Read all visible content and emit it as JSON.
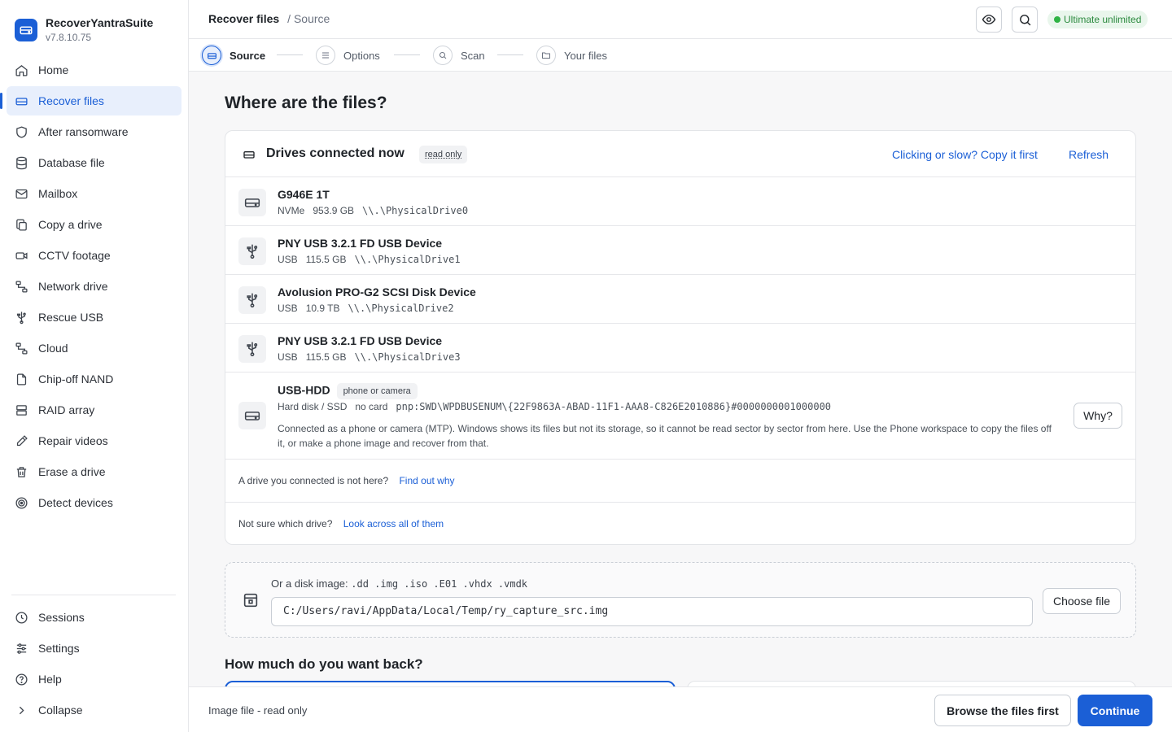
{
  "app": {
    "name": "RecoverYantraSuite",
    "version": "v7.8.10.75"
  },
  "sidebar": {
    "items": [
      {
        "label": "Home",
        "icon": "home-icon"
      },
      {
        "label": "Recover files",
        "icon": "drive-icon",
        "active": true
      },
      {
        "label": "After ransomware",
        "icon": "shield-icon"
      },
      {
        "label": "Database file",
        "icon": "database-icon"
      },
      {
        "label": "Mailbox",
        "icon": "mail-icon"
      },
      {
        "label": "Copy a drive",
        "icon": "copy-icon"
      },
      {
        "label": "CCTV footage",
        "icon": "camera-icon"
      },
      {
        "label": "Network drive",
        "icon": "network-icon"
      },
      {
        "label": "Rescue USB",
        "icon": "usb-icon"
      },
      {
        "label": "Cloud",
        "icon": "cloud-icon"
      },
      {
        "label": "Chip-off NAND",
        "icon": "chip-icon"
      },
      {
        "label": "RAID array",
        "icon": "raid-icon"
      },
      {
        "label": "Repair videos",
        "icon": "wrench-icon"
      },
      {
        "label": "Erase a drive",
        "icon": "trash-icon"
      },
      {
        "label": "Detect devices",
        "icon": "radar-icon"
      }
    ],
    "bottom": [
      {
        "label": "Sessions",
        "icon": "clock-icon"
      },
      {
        "label": "Settings",
        "icon": "sliders-icon"
      },
      {
        "label": "Help",
        "icon": "help-icon"
      },
      {
        "label": "Collapse",
        "icon": "chevron-right-icon"
      }
    ]
  },
  "header": {
    "title": "Recover files",
    "crumb": "/ Source",
    "plan": "Ultimate unlimited"
  },
  "steps": [
    {
      "label": "Source",
      "active": true
    },
    {
      "label": "Options"
    },
    {
      "label": "Scan"
    },
    {
      "label": "Your files"
    }
  ],
  "main": {
    "heading": "Where are the files?",
    "drives_title": "Drives connected now",
    "read_only": "read only",
    "copy_link": "Clicking or slow? Copy it first",
    "refresh": "Refresh",
    "drives": [
      {
        "name": "G946E 1T",
        "bus": "NVMe",
        "size": "953.9 GB",
        "path": "\\\\.\\PhysicalDrive0",
        "kind": "hdd"
      },
      {
        "name": "PNY USB 3.2.1 FD USB Device",
        "bus": "USB",
        "size": "115.5 GB",
        "path": "\\\\.\\PhysicalDrive1",
        "kind": "usb"
      },
      {
        "name": "Avolusion PRO-G2 SCSI Disk Device",
        "bus": "USB",
        "size": "10.9 TB",
        "path": "\\\\.\\PhysicalDrive2",
        "kind": "usb"
      },
      {
        "name": "PNY USB 3.2.1 FD USB Device",
        "bus": "USB",
        "size": "115.5 GB",
        "path": "\\\\.\\PhysicalDrive3",
        "kind": "usb"
      }
    ],
    "mtp": {
      "name": "USB-HDD",
      "badge": "phone or camera",
      "type": "Hard disk / SSD",
      "card": "no card",
      "path": "pnp:SWD\\WPDBUSENUM\\{22F9863A-ABAD-11F1-AAA8-C826E2010886}#0000000001000000",
      "desc": "Connected as a phone or camera (MTP). Windows shows its files but not its storage, so it cannot be read sector by sector from here. Use the Phone workspace to copy the files off it, or make a phone image and recover from that.",
      "why": "Why?"
    },
    "hint1": {
      "text": "A drive you connected is not here?",
      "link": "Find out why"
    },
    "hint2": {
      "text": "Not sure which drive?",
      "link": "Look across all of them"
    },
    "image": {
      "label": "Or a disk image:",
      "exts": ".dd  .img  .iso  .E01  .vhdx  .vmdk",
      "value": "C:/Users/ravi/AppData/Local/Temp/ry_capture_src.img",
      "choose": "Choose file"
    },
    "heading2": "How much do you want back?"
  },
  "footer": {
    "status": "Image file - read only",
    "secondary": "Browse the files first",
    "primary": "Continue"
  },
  "colors": {
    "accent": "#1b5fd6",
    "plan": "#2b8a3e"
  }
}
